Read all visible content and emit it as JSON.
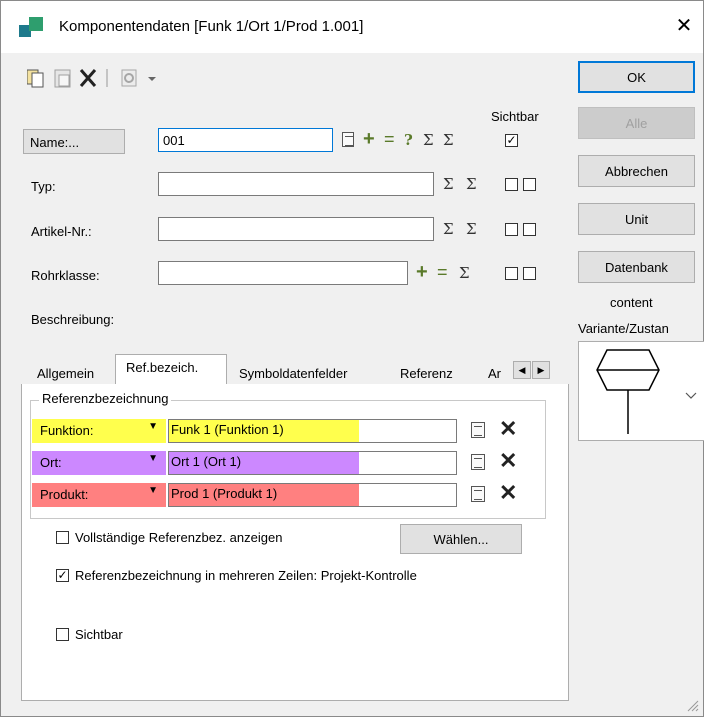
{
  "window": {
    "title": "Komponentendaten [Funk 1/Ort 1/Prod 1.001]",
    "close_glyph": "✕"
  },
  "buttons": {
    "ok": "OK",
    "alle": "Alle",
    "abbrechen": "Abbrechen",
    "unit": "Unit",
    "datenbank": "Datenbank"
  },
  "side": {
    "content_label": "content",
    "variant_label": "Variante/Zustan"
  },
  "form": {
    "sichtbar_header": "Sichtbar",
    "name_button": "Name:...",
    "name_value": "001",
    "typ_label": "Typ:",
    "artikel_label": "Artikel-Nr.:",
    "rohrklasse_label": "Rohrklasse:",
    "beschreibung_label": "Beschreibung:",
    "question_glyph": "?",
    "sigma_glyph": "Σ"
  },
  "tabs": [
    {
      "label": "Allgemein"
    },
    {
      "label": "Ref.bezeich."
    },
    {
      "label": "Symboldatenfelder"
    },
    {
      "label": "Referenz"
    },
    {
      "label": "Ar"
    }
  ],
  "refgroup": {
    "title": "Referenzbezeichnung",
    "rows": [
      {
        "type": "Funktion:",
        "value": "Funk 1   (Funktion 1)",
        "color": "#ffff4d"
      },
      {
        "type": "Ort:",
        "value": "Ort 1     (Ort 1)",
        "color": "#cc88ff"
      },
      {
        "type": "Produkt:",
        "value": "Prod 1   (Produkt 1)",
        "color": "#ff8080"
      }
    ],
    "vollstaendig_label": "Vollständige Referenzbez. anzeigen",
    "waehlen_button": "Wählen...",
    "mehrzeilen_label": "Referenzbezeichnung in mehreren Zeilen: Projekt-Kontrolle",
    "sichtbar_label": "Sichtbar"
  },
  "colors": {
    "accent": "#0078d7"
  }
}
